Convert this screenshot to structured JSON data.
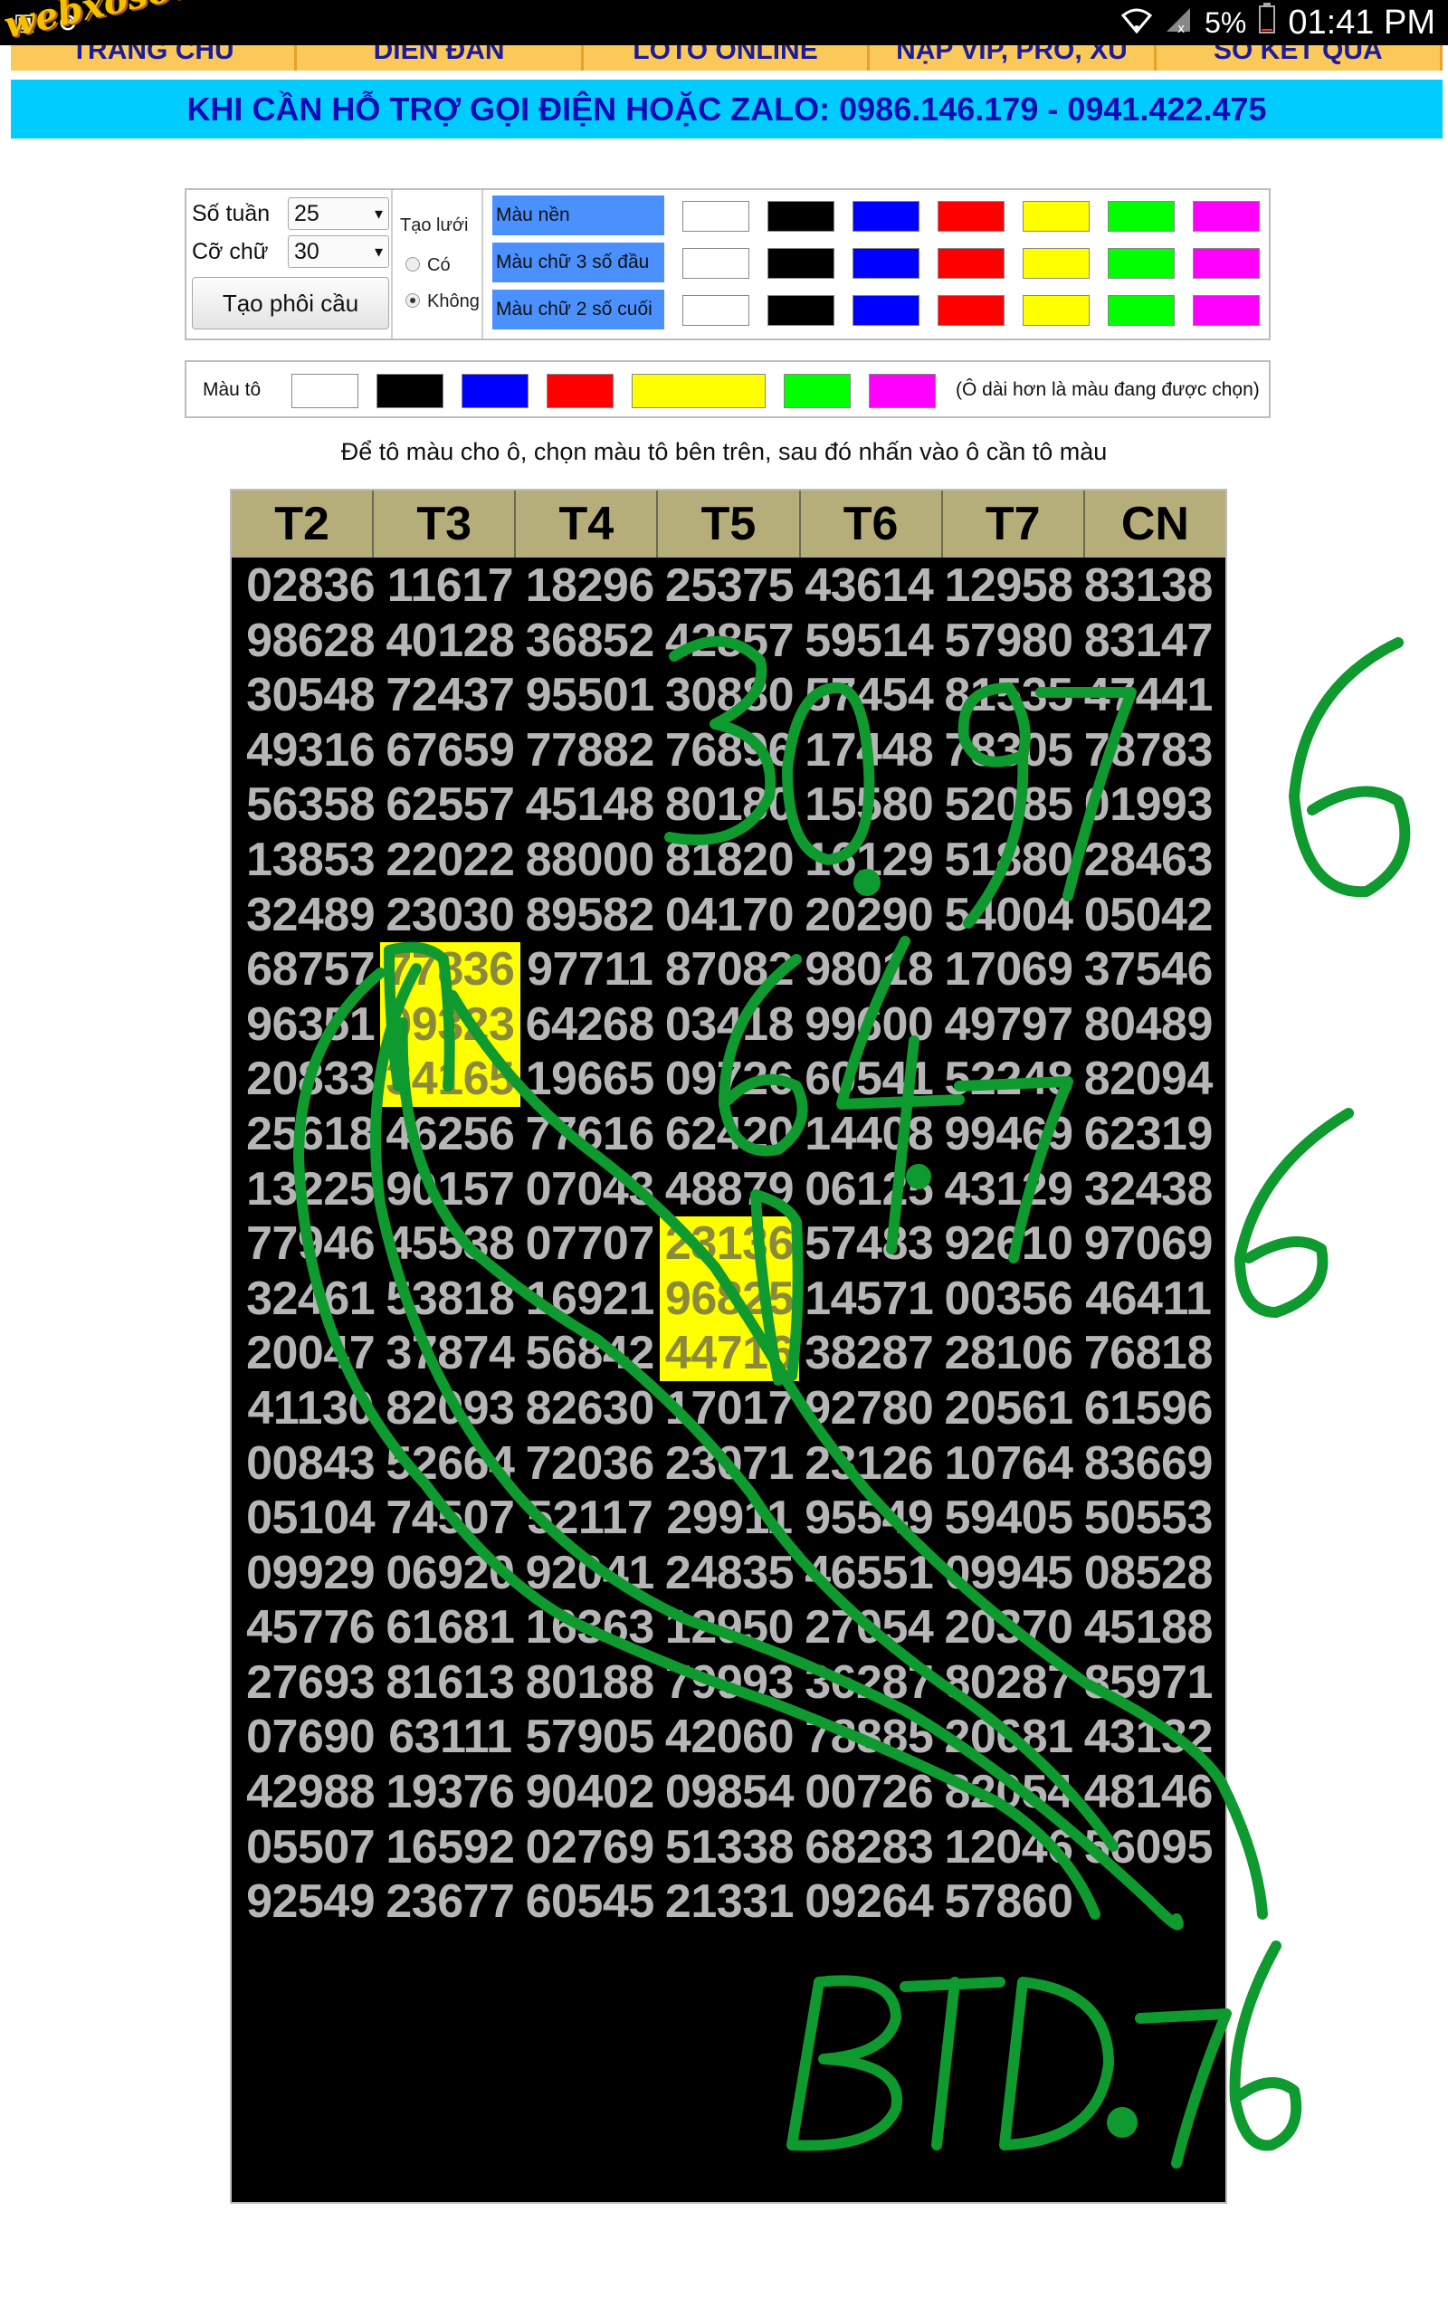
{
  "status_bar": {
    "icons_left": [
      "screenshot-icon",
      "compass-icon"
    ],
    "battery": "5%",
    "time": "01:41 PM"
  },
  "logo": "webxoso.net",
  "nav": {
    "items": [
      "TRANG CHỦ",
      "DIỄN ĐÀN",
      "LOTO ONLINE",
      "NẠP VIP, PRO, XU",
      "SỐ KẾT QUẢ"
    ]
  },
  "hotline": "KHI CẦN HỖ TRỢ GỌI ĐIỆN HOẶC ZALO: 0986.146.179 - 0941.422.475",
  "settings": {
    "so_tuan_label": "Số tuần",
    "so_tuan_value": "25",
    "co_chu_label": "Cỡ chữ",
    "co_chu_value": "30",
    "tao_phoi_button": "Tạo phôi cầu",
    "tao_luoi_label": "Tạo lưới",
    "tao_luoi_options": [
      "Có",
      "Không"
    ],
    "color_rows": [
      "Màu nền",
      "Màu chữ 3 số đầu",
      "Màu chữ 2 số cuối"
    ],
    "swatches": [
      "#ffffff",
      "#000000",
      "#0000ff",
      "#ff0000",
      "#ffff00",
      "#00ff00",
      "#ff00ff"
    ]
  },
  "mau_to": {
    "label": "Màu tô",
    "note": "(Ô dài hơn là màu đang được chọn)",
    "selected": "#ffff00"
  },
  "instruction": "Để tô màu cho ô, chọn màu tô bên trên, sau đó nhấn vào ô cần tô màu",
  "table": {
    "headers": [
      "T2",
      "T3",
      "T4",
      "T5",
      "T6",
      "T7",
      "CN"
    ],
    "rows": [
      [
        "02836",
        "11617",
        "18296",
        "25375",
        "43614",
        "12958",
        "83138"
      ],
      [
        "98628",
        "40128",
        "36852",
        "42857",
        "59514",
        "57980",
        "83147"
      ],
      [
        "30548",
        "72437",
        "95501",
        "30880",
        "57454",
        "81535",
        "47441"
      ],
      [
        "49316",
        "67659",
        "77882",
        "76896",
        "17448",
        "78305",
        "78783"
      ],
      [
        "56358",
        "62557",
        "45148",
        "80180",
        "15580",
        "52085",
        "01993"
      ],
      [
        "13853",
        "22022",
        "88000",
        "81820",
        "16129",
        "51880",
        "28463"
      ],
      [
        "32489",
        "23030",
        "89582",
        "04170",
        "20290",
        "54004",
        "05042"
      ],
      [
        "68757",
        "77836",
        "97711",
        "87082",
        "98018",
        "17069",
        "37546"
      ],
      [
        "96351",
        "09323",
        "64268",
        "03418",
        "99600",
        "49797",
        "80489"
      ],
      [
        "20833",
        "34165",
        "19665",
        "09726",
        "60541",
        "52248",
        "82094"
      ],
      [
        "25618",
        "46256",
        "77616",
        "62420",
        "14408",
        "99469",
        "62319"
      ],
      [
        "13225",
        "90157",
        "07043",
        "48879",
        "06125",
        "43129",
        "32438"
      ],
      [
        "77946",
        "45538",
        "07707",
        "23136",
        "57483",
        "92610",
        "97069"
      ],
      [
        "32461",
        "53818",
        "16921",
        "96825",
        "14571",
        "00356",
        "46411"
      ],
      [
        "20047",
        "37874",
        "56842",
        "44716",
        "38287",
        "28106",
        "76818"
      ],
      [
        "41130",
        "82093",
        "82630",
        "17017",
        "92780",
        "20561",
        "61596"
      ],
      [
        "00843",
        "52664",
        "72036",
        "23071",
        "23126",
        "10764",
        "83669"
      ],
      [
        "05104",
        "74507",
        "52117",
        "29911",
        "95549",
        "59405",
        "50553"
      ],
      [
        "09929",
        "06920",
        "92041",
        "24835",
        "46551",
        "09945",
        "08528"
      ],
      [
        "45776",
        "61681",
        "16363",
        "12950",
        "27054",
        "20370",
        "45188"
      ],
      [
        "27693",
        "81613",
        "80188",
        "79993",
        "36287",
        "80287",
        "85971"
      ],
      [
        "07690",
        "63111",
        "57905",
        "42060",
        "78885",
        "20681",
        "43132"
      ],
      [
        "42988",
        "19376",
        "90402",
        "09854",
        "00726",
        "82054",
        "48146"
      ],
      [
        "05507",
        "16592",
        "02769",
        "51338",
        "68283",
        "12046",
        "56095"
      ],
      [
        "92549",
        "23677",
        "60545",
        "21331",
        "09264",
        "57860",
        ""
      ]
    ],
    "highlighted": [
      [
        7,
        1
      ],
      [
        8,
        1
      ],
      [
        9,
        1
      ],
      [
        12,
        3
      ],
      [
        13,
        3
      ],
      [
        14,
        3
      ]
    ]
  },
  "handwriting": {
    "color": "#0e9a2e",
    "texts": [
      "30.976",
      "64.76",
      "BTD.76"
    ]
  }
}
